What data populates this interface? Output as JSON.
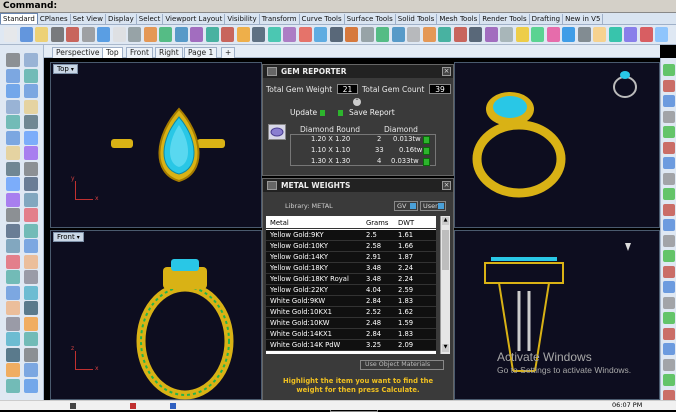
{
  "command_bar": {
    "label": "Command:"
  },
  "menu_tabs": [
    "Standard",
    "CPlanes",
    "Set View",
    "Display",
    "Select",
    "Viewport Layout",
    "Visibility",
    "Transform",
    "Curve Tools",
    "Surface Tools",
    "Solid Tools",
    "Mesh Tools",
    "Render Tools",
    "Drafting",
    "New in V5"
  ],
  "viewport_tabs": [
    "Perspective",
    "Top",
    "Front",
    "Right",
    "Page 1",
    "+"
  ],
  "viewports": {
    "top_label": "Top",
    "front_label": "Front",
    "axis_y": "y",
    "axis_x": "x",
    "axis_z": "z"
  },
  "gem_reporter": {
    "title": "GEM REPORTER",
    "total_weight_label": "Total Gem Weight",
    "total_weight_value": "21",
    "total_count_label": "Total Gem Count",
    "total_count_value": "39",
    "update_label": "Update",
    "save_label": "Save Report",
    "shape_label": "Diamond Round",
    "material_label": "Diamond",
    "rows": [
      {
        "size": "1.20 X 1.20",
        "count": "2",
        "weight": "0.013tw"
      },
      {
        "size": "1.10 X 1.10",
        "count": "33",
        "weight": "0.16tw"
      },
      {
        "size": "1.30 X 1.30",
        "count": "4",
        "weight": "0.033tw"
      }
    ]
  },
  "metal_weights": {
    "title": "METAL WEIGHTS",
    "library_label": "Library: METAL",
    "gv_label": "GV",
    "user_label": "User",
    "col_metal": "Metal",
    "col_grams": "Grams",
    "col_dwt": "DWT",
    "rows": [
      {
        "metal": "Yellow Gold:9KY",
        "grams": "2.5",
        "dwt": "1.61"
      },
      {
        "metal": "Yellow Gold:10KY",
        "grams": "2.58",
        "dwt": "1.66"
      },
      {
        "metal": "Yellow Gold:14KY",
        "grams": "2.91",
        "dwt": "1.87"
      },
      {
        "metal": "Yellow Gold:18KY",
        "grams": "3.48",
        "dwt": "2.24"
      },
      {
        "metal": "Yellow Gold:18KY Royal",
        "grams": "3.48",
        "dwt": "2.24"
      },
      {
        "metal": "Yellow Gold:22KY",
        "grams": "4.04",
        "dwt": "2.59"
      },
      {
        "metal": "White Gold:9KW",
        "grams": "2.84",
        "dwt": "1.83"
      },
      {
        "metal": "White Gold:10KX1",
        "grams": "2.52",
        "dwt": "1.62"
      },
      {
        "metal": "White Gold:10KW",
        "grams": "2.48",
        "dwt": "1.59"
      },
      {
        "metal": "White Gold:14KX1",
        "grams": "2.84",
        "dwt": "1.83"
      },
      {
        "metal": "White Gold:14K PdW",
        "grams": "3.25",
        "dwt": "2.09"
      }
    ],
    "use_object_materials": "Use Object Materials",
    "hint": "Highlight the item you want to find the weight for then press Calculate.",
    "calculate_label": "Calculate"
  },
  "watermark": {
    "title": "Activate Windows",
    "subtitle": "Go to Settings to activate Windows."
  },
  "taskbar": {
    "time": "06:07 PM"
  },
  "colors": {
    "accent": "#2db52d",
    "panel_bg": "#3a3a3a",
    "viewport_bg": "#0d0d1f",
    "gold": "#d9b215",
    "gem_blue": "#29c7e6"
  }
}
